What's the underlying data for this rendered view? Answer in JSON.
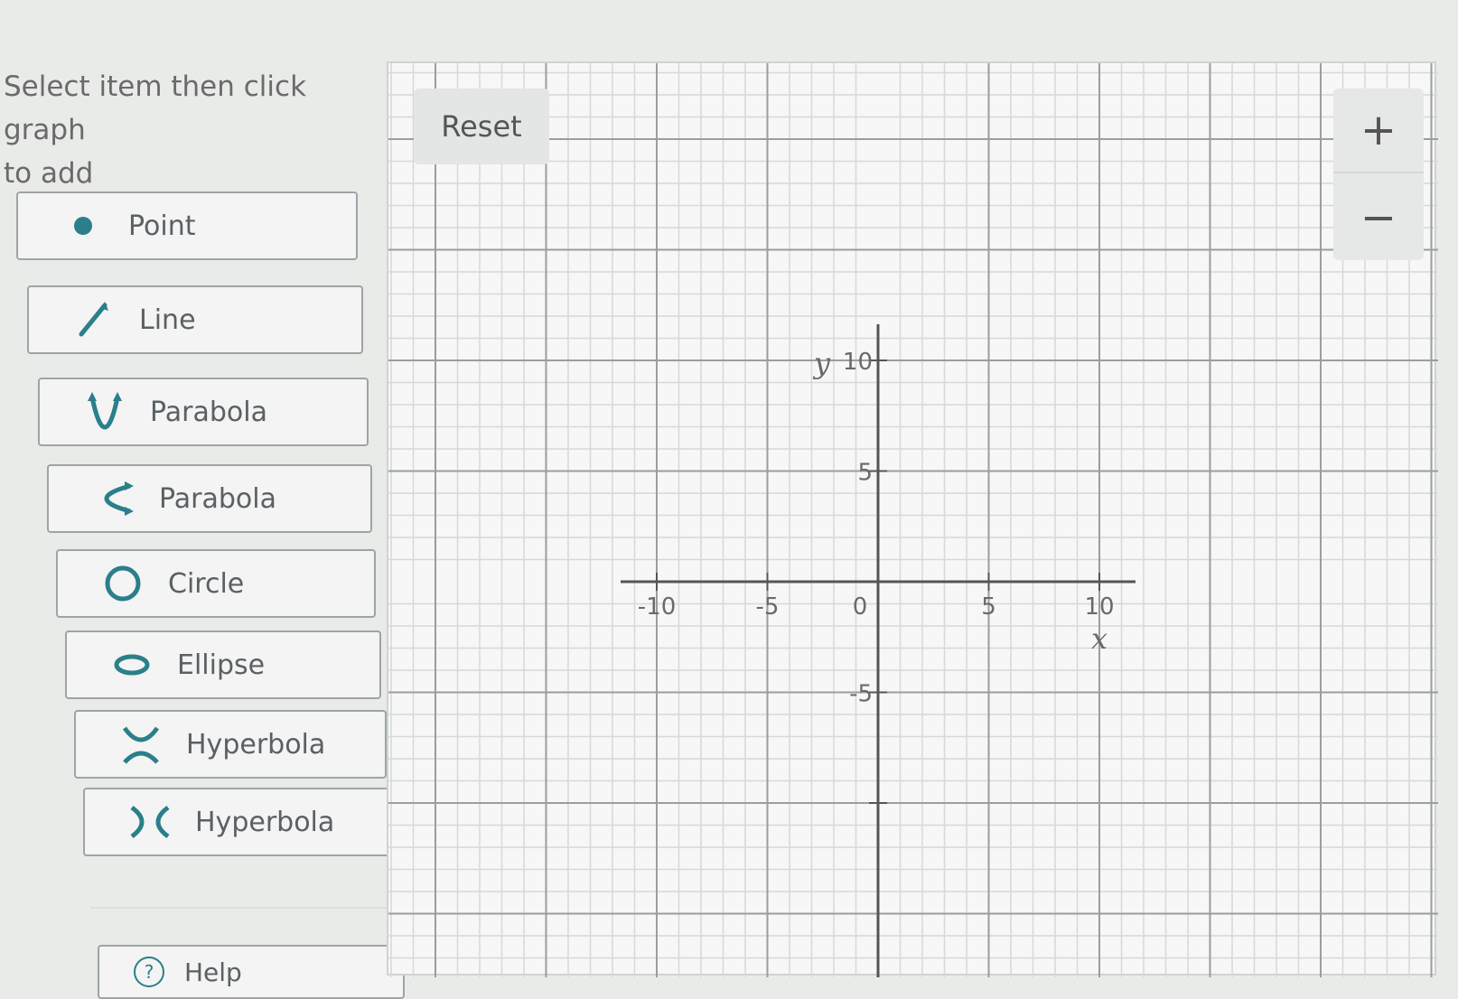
{
  "instructions": {
    "line1": "Select item then click graph",
    "line2": "to add"
  },
  "tools": [
    {
      "label": "Point",
      "icon": "point-icon"
    },
    {
      "label": "Line",
      "icon": "line-icon"
    },
    {
      "label": "Parabola",
      "icon": "parabola-vertical-icon"
    },
    {
      "label": "Parabola",
      "icon": "parabola-horizontal-icon"
    },
    {
      "label": "Circle",
      "icon": "circle-icon"
    },
    {
      "label": "Ellipse",
      "icon": "ellipse-icon"
    },
    {
      "label": "Hyperbola",
      "icon": "hyperbola-vertical-icon"
    },
    {
      "label": "Hyperbola",
      "icon": "hyperbola-horizontal-icon"
    }
  ],
  "help": {
    "label": "Help",
    "icon": "help-icon"
  },
  "graph": {
    "reset_label": "Reset",
    "zoom_in_label": "+",
    "zoom_out_label": "−",
    "x_axis_label": "x",
    "y_axis_label": "y",
    "x_range": [
      -10,
      10
    ],
    "y_range": [
      -10,
      10
    ],
    "x_ticks": [
      "-10",
      "-5",
      "0",
      "5",
      "10"
    ],
    "y_ticks": [
      "10",
      "5",
      "-5"
    ],
    "grid_step": 1,
    "labeled_step": 5
  },
  "colors": {
    "accent": "#2a7f8a",
    "grid_minor": "#d6d9d8",
    "grid_major": "#9a9e9d",
    "axis": "#555555"
  }
}
